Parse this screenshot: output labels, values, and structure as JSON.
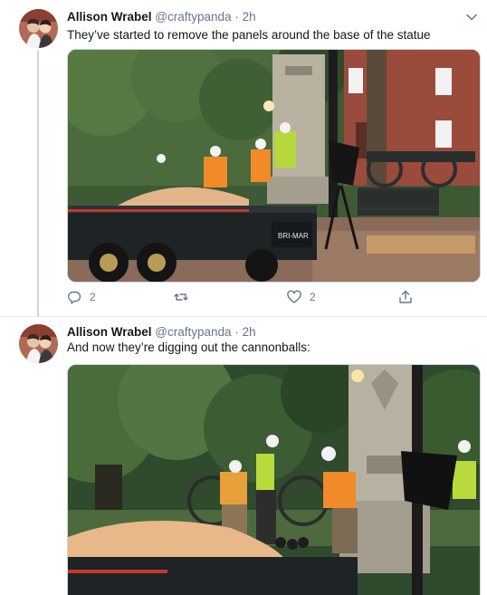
{
  "tweets": [
    {
      "author_name": "Allison Wrabel",
      "handle": "@craftypanda",
      "separator": "·",
      "time": "2h",
      "text": "They’ve started to remove the panels around the base of the statue",
      "reply_count": "2",
      "retweet_count": "",
      "like_count": "2",
      "media_description_sign": "BRI-MAR"
    },
    {
      "author_name": "Allison Wrabel",
      "handle": "@craftypanda",
      "separator": "·",
      "time": "2h",
      "text": "And now they’re digging out the cannonballs:"
    }
  ],
  "icons": [
    "more-caret-icon",
    "reply-icon",
    "retweet-icon",
    "like-icon",
    "share-icon"
  ],
  "colors": {
    "text": "#14171a",
    "secondary": "#657786",
    "border": "#e6ecf0",
    "thread_line": "#ccd6dd"
  }
}
